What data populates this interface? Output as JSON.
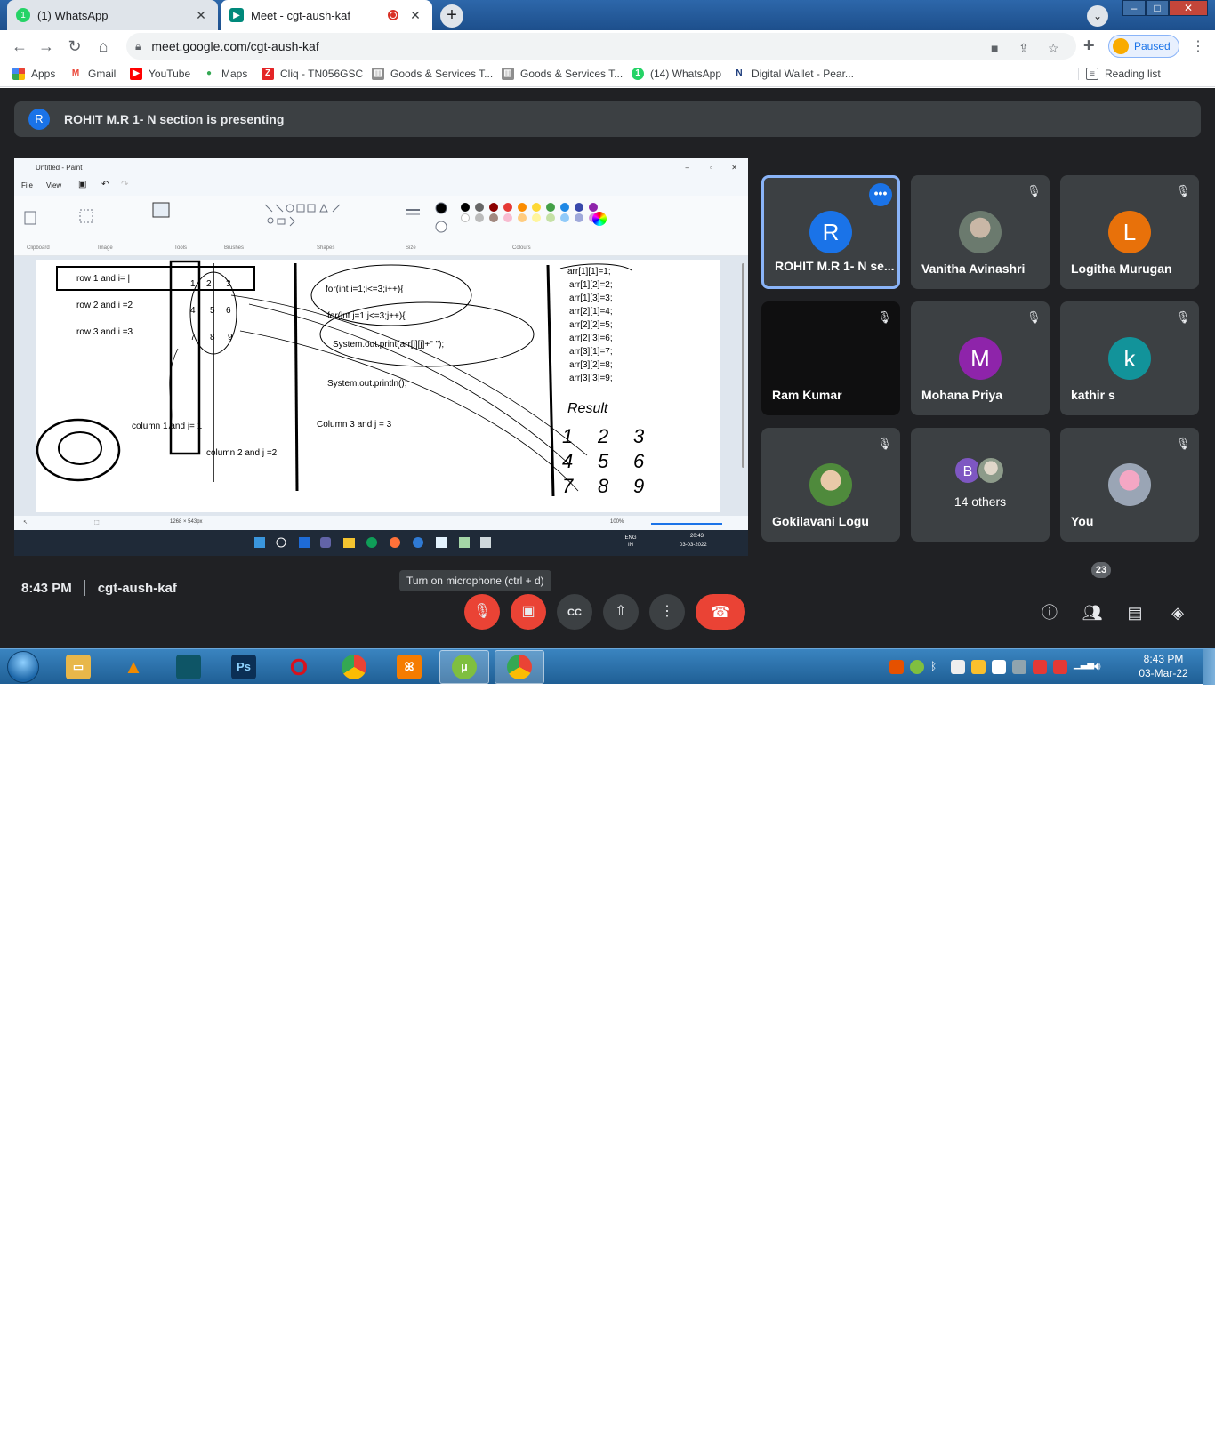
{
  "browser": {
    "tabs": [
      {
        "title": "(1) WhatsApp",
        "state": "inactive",
        "favicon_color": "#25d366"
      },
      {
        "title": "Meet - cgt-aush-kaf",
        "state": "active",
        "favicon_color": "#00897b"
      }
    ],
    "url": "meet.google.com/cgt-aush-kaf",
    "profile_status": "Paused",
    "bookmarks": [
      {
        "label": "Apps",
        "icon": "apps-grid-icon"
      },
      {
        "label": "Gmail",
        "icon": "gmail-icon"
      },
      {
        "label": "YouTube",
        "icon": "youtube-icon"
      },
      {
        "label": "Maps",
        "icon": "maps-pin-icon"
      },
      {
        "label": "Cliq - TN056GSC",
        "icon": "zoho-icon"
      },
      {
        "label": "Goods & Services T...",
        "icon": "gov-emblem-icon"
      },
      {
        "label": "Goods & Services T...",
        "icon": "gov-emblem-icon"
      },
      {
        "label": "(14) WhatsApp",
        "icon": "whatsapp-icon"
      },
      {
        "label": "Digital Wallet - Pear...",
        "icon": "wallet-icon"
      }
    ],
    "reading_list": "Reading list"
  },
  "meet": {
    "presenting_banner": "ROHIT M.R 1- N section is presenting",
    "presenter_initial": "R",
    "shared_screen": {
      "app_title": "Untitled - Paint",
      "menu": [
        "File",
        "View"
      ],
      "ribbon_groups": [
        "Clipboard",
        "Image",
        "Tools",
        "Brushes",
        "Shapes",
        "Size",
        "Colours"
      ],
      "canvas_text": {
        "rows": [
          "row 1 and i= |",
          "row 2 and i =2",
          "row 3 and i =3"
        ],
        "matrix": [
          "1",
          "2",
          "3",
          "4",
          "5",
          "6",
          "7",
          "8",
          "9"
        ],
        "columns": [
          "column 1 and j= 1",
          "column 2 and j =2",
          "Column 3 and j = 3"
        ],
        "code": [
          "for(int i=1;i<=3;i++){",
          "for(int j=1;j<=3;j++){",
          "System.out.print(arr[i][j]+\" \");",
          "System.out.println();"
        ],
        "assignments": [
          "arr[1][1]=1;",
          "arr[1][2]=2;",
          "arr[1][3]=3;",
          "arr[2][1]=4;",
          "arr[2][2]=5;",
          "arr[2][3]=6;",
          "arr[3][1]=7;",
          "arr[3][2]=8;",
          "arr[3][3]=9;"
        ],
        "result_label": "Result"
      },
      "status_size": "1268 × 543px",
      "zoom": "100%",
      "win_clock_time": "20:43",
      "win_clock_date": "03-03-2022",
      "win_lang": "ENG IN"
    },
    "participants": [
      {
        "name": "ROHIT M.R 1- N se...",
        "initial": "R",
        "color": "#1a73e8",
        "speaking": true,
        "muted": false
      },
      {
        "name": "Vanitha Avinashri",
        "initial": "",
        "color": "",
        "photo": true,
        "muted": true
      },
      {
        "name": "Logitha Murugan",
        "initial": "L",
        "color": "#e8710a",
        "muted": true
      },
      {
        "name": "Ram Kumar",
        "initial": "",
        "color": "",
        "dark": true,
        "muted": true
      },
      {
        "name": "Mohana Priya",
        "initial": "M",
        "color": "#8e24aa",
        "muted": true
      },
      {
        "name": "kathir s",
        "initial": "k",
        "color": "#12939a",
        "muted": true
      },
      {
        "name": "Gokilavani Logu",
        "initial": "",
        "photo": true,
        "muted": true
      },
      {
        "name": "14 others",
        "initial": "B",
        "others": true
      },
      {
        "name": "You",
        "initial": "",
        "photo": true,
        "muted": true
      }
    ],
    "tooltip": "Turn on microphone (ctrl + d)",
    "time": "8:43 PM",
    "meeting_code": "cgt-aush-kaf",
    "people_count": "23"
  },
  "os": {
    "clock_time": "8:43 PM",
    "clock_date": "03-Mar-22",
    "taskbar_apps": [
      {
        "name": "explorer",
        "icon": "folder-icon",
        "color": "#e8b74a",
        "glyph": "▭"
      },
      {
        "name": "vlc",
        "icon": "vlc-cone-icon",
        "color": "#f08a00",
        "glyph": "▲"
      },
      {
        "name": "app",
        "icon": "teal-app-icon",
        "color": "#0e5566",
        "glyph": ""
      },
      {
        "name": "photoshop",
        "icon": "photoshop-icon",
        "color": "#0b2f55",
        "glyph": "Ps"
      },
      {
        "name": "opera",
        "icon": "opera-icon",
        "color": "#d8121d",
        "glyph": "O"
      },
      {
        "name": "chrome",
        "icon": "chrome-icon",
        "color": "#1e8e3e",
        "glyph": "◉"
      },
      {
        "name": "xampp",
        "icon": "xampp-icon",
        "color": "#f57c00",
        "glyph": "ꕤ"
      },
      {
        "name": "utorrent",
        "icon": "utorrent-icon",
        "color": "#7fbf3f",
        "glyph": "µ"
      },
      {
        "name": "chrome-profile",
        "icon": "chrome-profile-icon",
        "color": "#d93025",
        "glyph": "◉"
      }
    ]
  }
}
